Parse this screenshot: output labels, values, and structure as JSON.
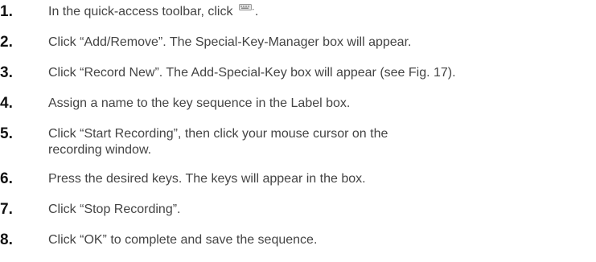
{
  "steps": [
    {
      "number": "1.",
      "text_before": "In the quick-access toolbar, click",
      "icon": "keyboard-icon",
      "text_after": "."
    },
    {
      "number": "2.",
      "text": "Click “Add/Remove”. The Special-Key-Manager box will appear."
    },
    {
      "number": "3.",
      "text": "Click “Record New”. The Add-Special-Key box will appear (see Fig. 17)."
    },
    {
      "number": "4.",
      "text": "Assign a name to the key sequence in the Label box."
    },
    {
      "number": "5.",
      "line1": "Click “Start Recording”, then click your mouse cursor on the",
      "line2": "recording window."
    },
    {
      "number": "6.",
      "text": "Press the desired keys. The keys will appear in the box."
    },
    {
      "number": "7.",
      "text": "Click “Stop Recording”."
    },
    {
      "number": "8.",
      "text": "Click “OK” to complete and save the sequence."
    }
  ]
}
